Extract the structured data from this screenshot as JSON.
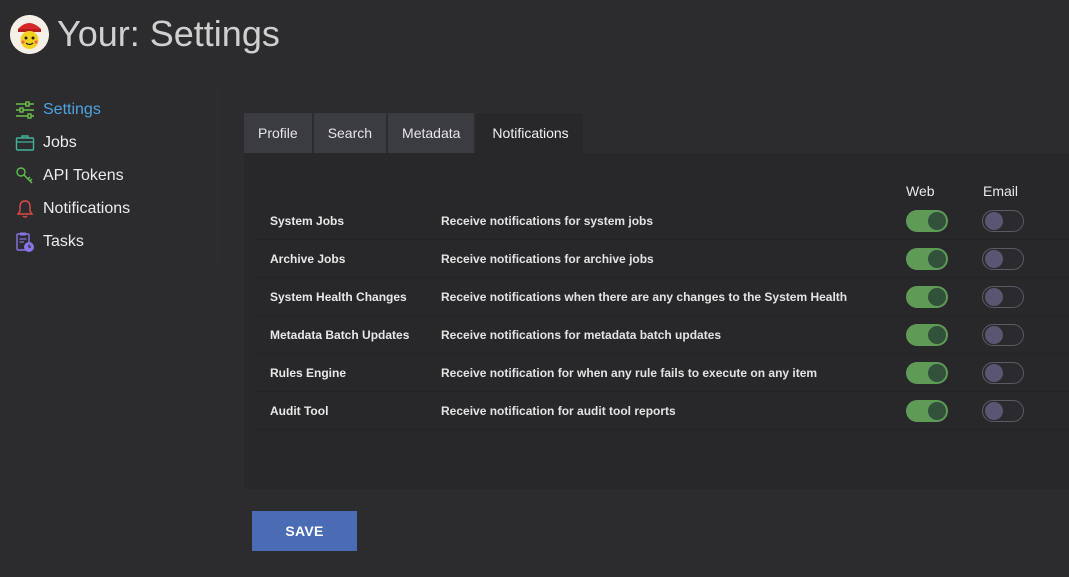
{
  "header": {
    "title_part1": "Your",
    "title_sep": ": ",
    "title_part2": "Settings"
  },
  "sidebar": {
    "items": [
      {
        "label": "Settings",
        "icon": "sliders-icon",
        "active": true,
        "color": "#4ca3e0"
      },
      {
        "label": "Jobs",
        "icon": "briefcase-icon",
        "color": "#3fb39a"
      },
      {
        "label": "API Tokens",
        "icon": "key-icon",
        "color": "#5fbf4f"
      },
      {
        "label": "Notifications",
        "icon": "bell-icon",
        "color": "#e04848"
      },
      {
        "label": "Tasks",
        "icon": "clipboard-clock-icon",
        "color": "#8a73e6"
      }
    ]
  },
  "tabs": [
    {
      "label": "Profile"
    },
    {
      "label": "Search"
    },
    {
      "label": "Metadata"
    },
    {
      "label": "Notifications",
      "active": true
    }
  ],
  "notifications": {
    "columns": {
      "web": "Web",
      "email": "Email"
    },
    "rows": [
      {
        "name": "System Jobs",
        "description": "Receive notifications for system jobs",
        "web": true,
        "email": false
      },
      {
        "name": "Archive Jobs",
        "description": "Receive notifications for archive jobs",
        "web": true,
        "email": false
      },
      {
        "name": "System Health Changes",
        "description": "Receive notifications when there are any changes to the System Health",
        "web": true,
        "email": false
      },
      {
        "name": "Metadata Batch Updates",
        "description": "Receive notifications for metadata batch updates",
        "web": true,
        "email": false
      },
      {
        "name": "Rules Engine",
        "description": "Receive notification for when any rule fails to execute on any item",
        "web": true,
        "email": false
      },
      {
        "name": "Audit Tool",
        "description": "Receive notification for audit tool reports",
        "web": true,
        "email": false
      }
    ]
  },
  "actions": {
    "save_label": "SAVE"
  },
  "colors": {
    "accent": "#4ca3e0",
    "toggle_on": "#5f9a57",
    "save_button": "#4a6cb5"
  }
}
